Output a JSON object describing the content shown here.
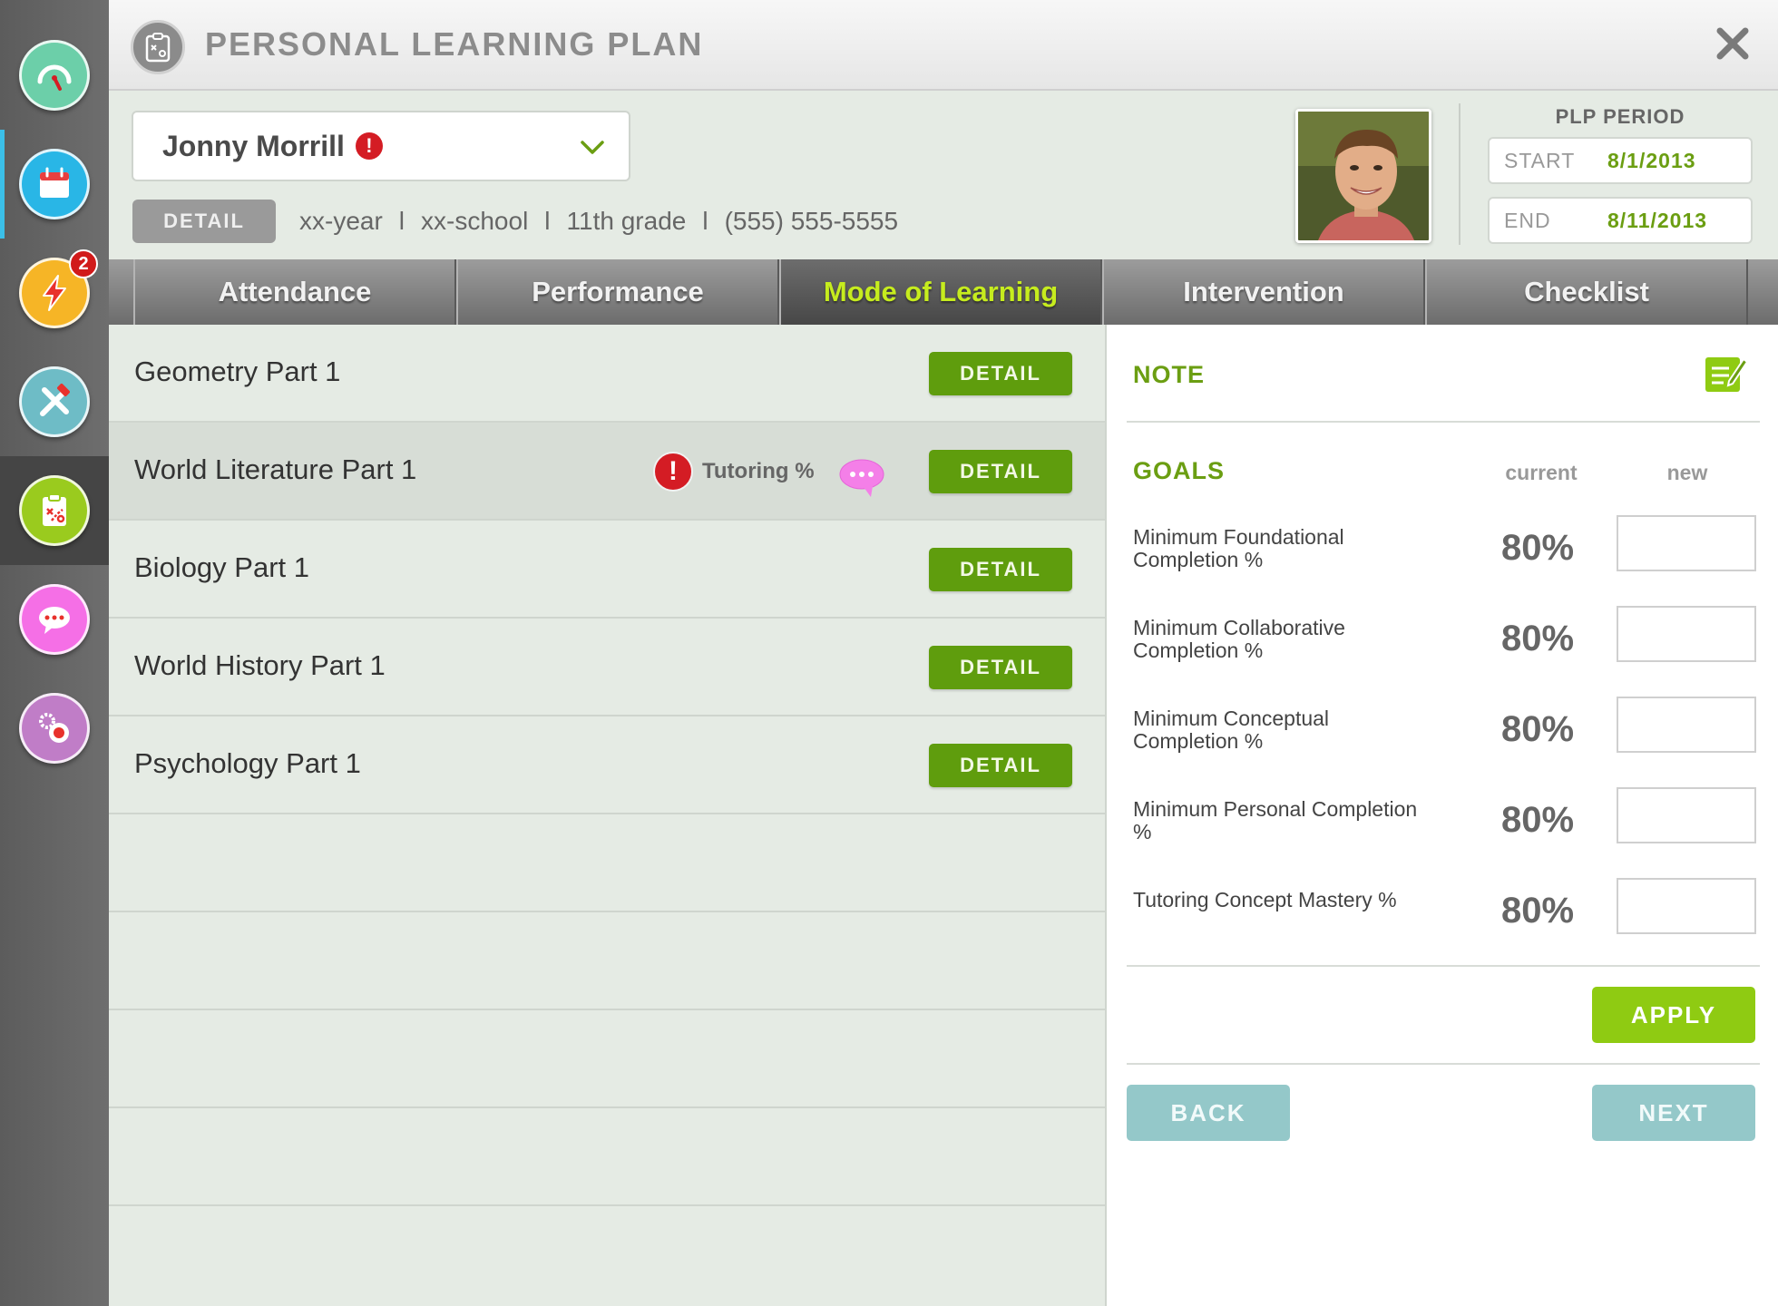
{
  "header": {
    "title": "PERSONAL LEARNING PLAN"
  },
  "sidebar": {
    "items": [
      {
        "name": "dashboard",
        "color": "#6ccfa9"
      },
      {
        "name": "calendar",
        "color": "#29b6e6"
      },
      {
        "name": "alerts",
        "color": "#f6b526",
        "badge": "2"
      },
      {
        "name": "tools",
        "color": "#6ebcc6"
      },
      {
        "name": "learning-plan",
        "color": "#9acb1e"
      },
      {
        "name": "messages",
        "color": "#f56fe6"
      },
      {
        "name": "settings",
        "color": "#c07dc7"
      }
    ]
  },
  "student": {
    "name": "Jonny Morrill",
    "detail_label": "DETAIL",
    "year": "xx-year",
    "school": "xx-school",
    "grade": "11th grade",
    "phone": "(555) 555-5555",
    "separator": "l"
  },
  "plp_period": {
    "title": "PLP PERIOD",
    "start_label": "START",
    "start_value": "8/1/2013",
    "end_label": "END",
    "end_value": "8/11/2013"
  },
  "tabs": [
    {
      "label": "Attendance"
    },
    {
      "label": "Performance"
    },
    {
      "label": "Mode of Learning"
    },
    {
      "label": "Intervention"
    },
    {
      "label": "Checklist"
    }
  ],
  "courses": [
    {
      "name": "Geometry Part 1",
      "button": "DETAIL"
    },
    {
      "name": "World Literature Part 1",
      "button": "DETAIL",
      "flag": "Tutoring %"
    },
    {
      "name": "Biology Part 1",
      "button": "DETAIL"
    },
    {
      "name": "World History Part 1",
      "button": "DETAIL"
    },
    {
      "name": "Psychology Part 1",
      "button": "DETAIL"
    }
  ],
  "note": {
    "title": "NOTE"
  },
  "goals": {
    "title": "GOALS",
    "col_current": "current",
    "col_new": "new",
    "items": [
      {
        "label": "Minimum Foundational Completion %",
        "current": "80%",
        "new": ""
      },
      {
        "label": "Minimum Collaborative Completion %",
        "current": "80%",
        "new": ""
      },
      {
        "label": "Minimum Conceptual Completion %",
        "current": "80%",
        "new": ""
      },
      {
        "label": "Minimum Personal Completion %",
        "current": "80%",
        "new": ""
      },
      {
        "label": "Tutoring Concept Mastery %",
        "current": "80%",
        "new": ""
      }
    ]
  },
  "actions": {
    "apply": "APPLY",
    "back": "BACK",
    "next": "NEXT"
  },
  "colors": {
    "accent_green": "#6b9e12",
    "detail_green": "#5f9d0d",
    "apply_green": "#8fcb12",
    "nav_teal": "#94c8c9",
    "alert_red": "#d41c24"
  }
}
